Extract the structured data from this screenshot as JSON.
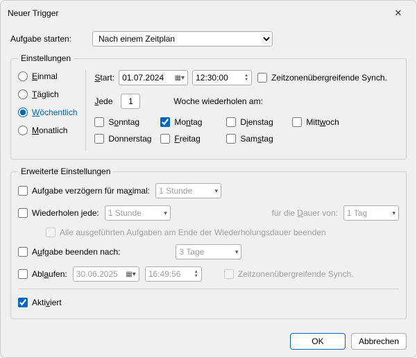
{
  "title": "Neuer Trigger",
  "close_icon": "✕",
  "begin": {
    "label_pre": "Aufgabe starten:",
    "label_u": "",
    "value": "Nach einem Zeitplan"
  },
  "settings": {
    "legend": "Einstellungen",
    "radios": {
      "einmal": "Einmal",
      "taglich": "Täglich",
      "wochen": "Wöchentlich",
      "monat": "Monatlich"
    },
    "start_label": "Start:",
    "start_date": "01.07.2024",
    "start_time": "12:30:00",
    "tz_label": "Zeitzonenübergreifende Synch.",
    "jede_label": "Jede",
    "jede_value": "1",
    "wieder_label": "Woche wiederholen am:",
    "days": {
      "sonntag": "Sonntag",
      "montag": "Montag",
      "dienstag": "Dienstag",
      "mittwoch": "Mittwoch",
      "donnerstag": "Donnerstag",
      "freitag": "Freitag",
      "samstag": "Samstag"
    }
  },
  "adv": {
    "legend": "Erweiterte Einstellungen",
    "delay_label": "Aufgabe verzögern für maximal:",
    "delay_value": "1 Stunde",
    "repeat_label": "Wiederholen jede:",
    "repeat_value": "1 Stunde",
    "duration_label": "für die Dauer von:",
    "duration_value": "1 Tag",
    "stop_all_label": "Alle ausgeführten Aufgaben am Ende der Wiederholungsdauer beenden",
    "stop_after_label": "Aufgabe beenden nach:",
    "stop_after_value": "3 Tage",
    "expire_label": "Ablaufen:",
    "expire_date": "30.06.2025",
    "expire_time": "16:49:56",
    "tz2_label": "Zeitzonenübergreifende Synch.",
    "aktiviert": "Aktiviert"
  },
  "footer": {
    "ok": "OK",
    "cancel": "Abbrechen"
  }
}
